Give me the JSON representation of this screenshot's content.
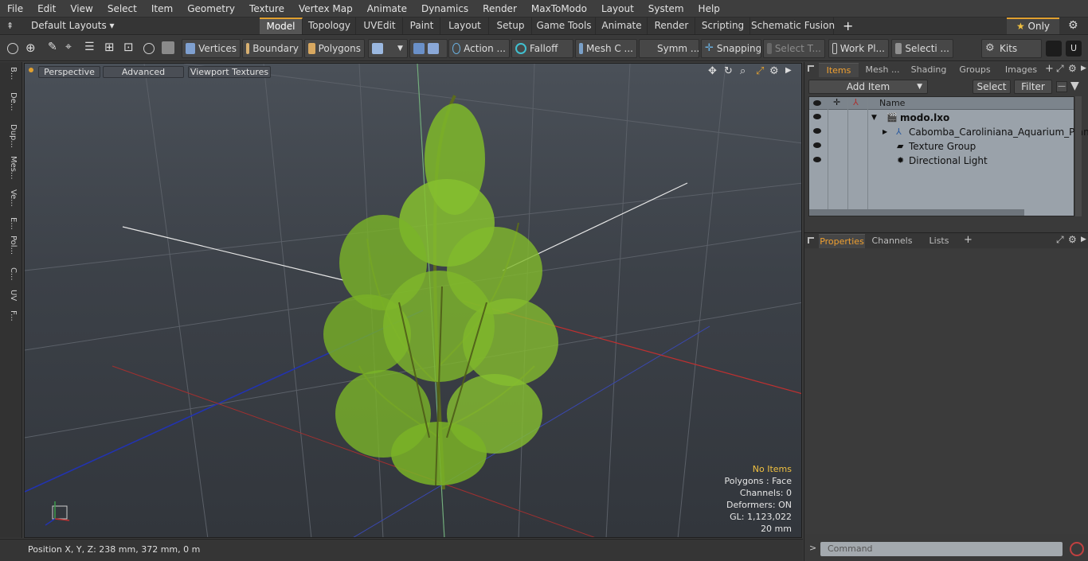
{
  "menu": [
    "File",
    "Edit",
    "View",
    "Select",
    "Item",
    "Geometry",
    "Texture",
    "Vertex Map",
    "Animate",
    "Dynamics",
    "Render",
    "MaxToModo",
    "Layout",
    "System",
    "Help"
  ],
  "layouts": {
    "label": "Default Layouts"
  },
  "tabs": [
    {
      "label": "Model",
      "active": true
    },
    {
      "label": "Topology"
    },
    {
      "label": "UVEdit"
    },
    {
      "label": "Paint"
    },
    {
      "label": "Layout"
    },
    {
      "label": "Setup"
    },
    {
      "label": "Game Tools"
    },
    {
      "label": "Animate"
    },
    {
      "label": "Render"
    },
    {
      "label": "Scripting"
    },
    {
      "label": "Schematic Fusion"
    }
  ],
  "only_label": "Only",
  "toolbar": {
    "vertices": "Vertices",
    "boundary": "Boundary",
    "polygons": "Polygons",
    "action": "Action ...",
    "falloff": "Falloff",
    "mesh": "Mesh C ...",
    "symm": "Symm ...",
    "snapping": "Snapping",
    "select_t": "Select T...",
    "workpl": "Work Pl...",
    "selecti": "Selecti ...",
    "kits": "Kits"
  },
  "left_tabs": [
    "B...",
    "De...",
    "Dup...",
    "Mes...",
    "Ve...",
    "E...",
    "Pol...",
    "C...",
    "UV",
    "F..."
  ],
  "viewport": {
    "perspective": "Perspective",
    "advanced": "Advanced",
    "textures": "Viewport Textures"
  },
  "stats": {
    "no_items": "No Items",
    "polygons": "Polygons : Face",
    "channels": "Channels: 0",
    "deformers": "Deformers: ON",
    "gl": "GL: 1,123,022",
    "scale": "20 mm"
  },
  "status": {
    "position": "Position X, Y, Z:  238 mm, 372 mm, 0 m"
  },
  "panel": {
    "tabs": [
      "Items",
      "Mesh ...",
      "Shading",
      "Groups",
      "Images"
    ],
    "add_item": "Add Item",
    "select": "Select",
    "filter": "Filter",
    "col_name": "Name"
  },
  "items": [
    {
      "name": "modo.lxo",
      "bold": true
    },
    {
      "name": "Cabomba_Caroliniana_Aquarium_Plant"
    },
    {
      "name": "Texture Group"
    },
    {
      "name": "Directional Light"
    }
  ],
  "props": {
    "tabs": [
      "Properties",
      "Channels",
      "Lists"
    ]
  },
  "command": {
    "placeholder": "Command"
  },
  "colors": {
    "accent": "#f0a030",
    "leaf": "#7fb82a",
    "stem": "#5b6a1e"
  }
}
